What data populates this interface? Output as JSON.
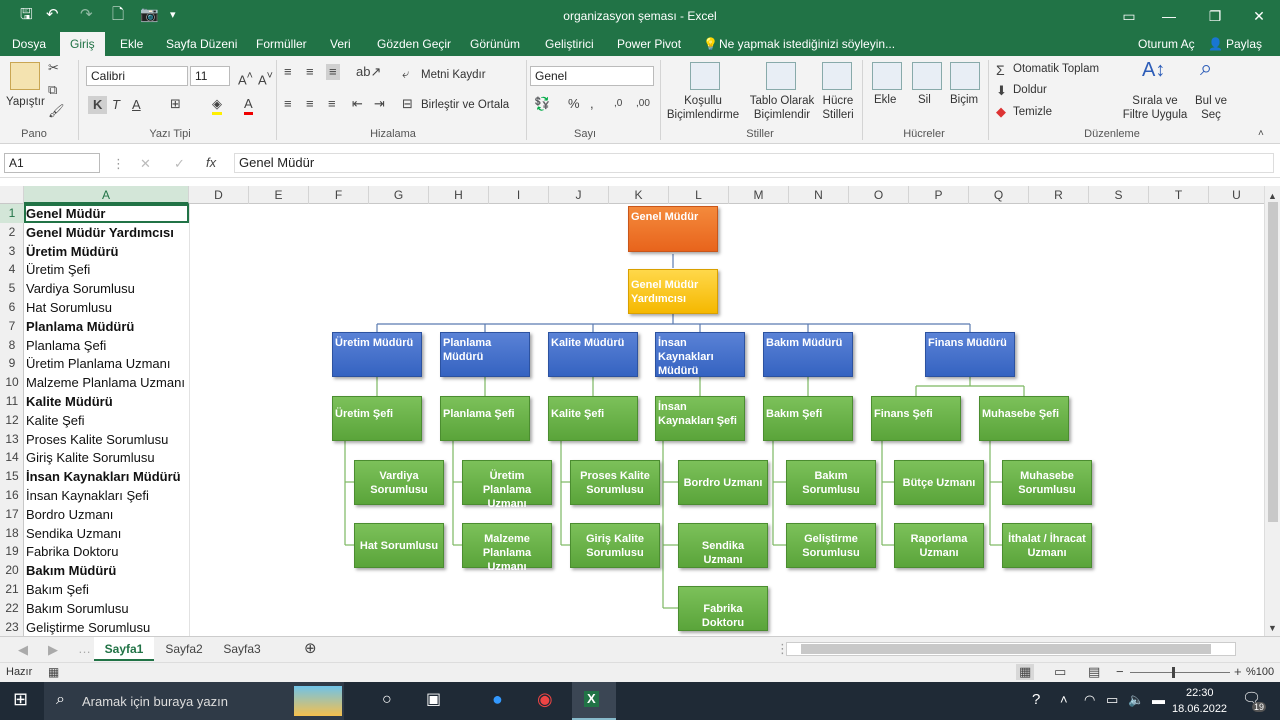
{
  "window": {
    "title": "organizasyon şeması - Excel"
  },
  "ribbon_tabs": [
    "Dosya",
    "Giriş",
    "Ekle",
    "Sayfa Düzeni",
    "Formüller",
    "Veri",
    "Gözden Geçir",
    "Görünüm",
    "Geliştirici",
    "Power Pivot"
  ],
  "tell_me": "Ne yapmak istediğinizi söyleyin...",
  "signin": "Oturum Aç",
  "share": "Paylaş",
  "ribbon": {
    "paste": "Yapıştır",
    "font_name": "Calibri",
    "font_size": "11",
    "wrap_text": "Metni Kaydır",
    "merge_center": "Birleştir ve Ortala",
    "number_format": "Genel",
    "conditional": "Koşullu Biçimlendirme",
    "table_format": "Tablo Olarak Biçimlendir",
    "cell_styles": "Hücre Stilleri",
    "insert": "Ekle",
    "delete": "Sil",
    "format": "Biçim",
    "autosum": "Otomatik Toplam",
    "fill": "Doldur",
    "clear": "Temizle",
    "sort_filter": "Sırala ve Filtre Uygula",
    "find_select": "Bul ve Seç",
    "groups": {
      "clipboard": "Pano",
      "font": "Yazı Tipi",
      "alignment": "Hizalama",
      "number": "Sayı",
      "styles": "Stiller",
      "cells": "Hücreler",
      "editing": "Düzenleme"
    }
  },
  "formula_bar": {
    "namebox": "A1",
    "content": "Genel Müdür"
  },
  "columns": [
    "A",
    "D",
    "E",
    "F",
    "G",
    "H",
    "I",
    "J",
    "K",
    "L",
    "M",
    "N",
    "O",
    "P",
    "Q",
    "R",
    "S",
    "T",
    "U"
  ],
  "rows": [
    {
      "n": "1",
      "text": "Genel Müdür",
      "bold": true
    },
    {
      "n": "2",
      "text": "Genel Müdür Yardımcısı",
      "bold": true
    },
    {
      "n": "3",
      "text": "Üretim Müdürü",
      "bold": true
    },
    {
      "n": "4",
      "text": "Üretim Şefi",
      "bold": false
    },
    {
      "n": "5",
      "text": "Vardiya Sorumlusu",
      "bold": false
    },
    {
      "n": "6",
      "text": "Hat Sorumlusu",
      "bold": false
    },
    {
      "n": "7",
      "text": "Planlama Müdürü",
      "bold": true
    },
    {
      "n": "8",
      "text": "Planlama Şefi",
      "bold": false
    },
    {
      "n": "9",
      "text": "Üretim Planlama Uzmanı",
      "bold": false
    },
    {
      "n": "10",
      "text": "Malzeme Planlama Uzmanı",
      "bold": false
    },
    {
      "n": "11",
      "text": "Kalite Müdürü",
      "bold": true
    },
    {
      "n": "12",
      "text": "Kalite Şefi",
      "bold": false
    },
    {
      "n": "13",
      "text": "Proses Kalite Sorumlusu",
      "bold": false
    },
    {
      "n": "14",
      "text": "Giriş Kalite Sorumlusu",
      "bold": false
    },
    {
      "n": "15",
      "text": "İnsan Kaynakları Müdürü",
      "bold": true
    },
    {
      "n": "16",
      "text": "İnsan Kaynakları Şefi",
      "bold": false
    },
    {
      "n": "17",
      "text": "Bordro Uzmanı",
      "bold": false
    },
    {
      "n": "18",
      "text": "Sendika Uzmanı",
      "bold": false
    },
    {
      "n": "19",
      "text": "Fabrika Doktoru",
      "bold": false
    },
    {
      "n": "20",
      "text": "Bakım Müdürü",
      "bold": true
    },
    {
      "n": "21",
      "text": "Bakım Şefi",
      "bold": false
    },
    {
      "n": "22",
      "text": "Bakım Sorumlusu",
      "bold": false
    },
    {
      "n": "23",
      "text": "Geliştirme Sorumlusu",
      "bold": false
    }
  ],
  "org": {
    "ceo": "Genel Müdür",
    "deputy": "Genel Müdür Yardımcısı",
    "managers": [
      "Üretim Müdürü",
      "Planlama Müdürü",
      "Kalite Müdürü",
      "İnsan Kaynakları Müdürü",
      "Bakım Müdürü",
      "Finans Müdürü"
    ],
    "chiefs": [
      "Üretim Şefi",
      "Planlama Şefi",
      "Kalite Şefi",
      "İnsan Kaynakları Şefi",
      "Bakım Şefi",
      "Finans Şefi",
      "Muhasebe Şefi"
    ],
    "staff": [
      [
        "Vardiya Sorumlusu",
        "Hat Sorumlusu"
      ],
      [
        "Üretim Planlama Uzmanı",
        "Malzeme Planlama Uzmanı"
      ],
      [
        "Proses Kalite Sorumlusu",
        "Giriş Kalite Sorumlusu"
      ],
      [
        "Bordro Uzmanı",
        "Sendika Uzmanı",
        "Fabrika Doktoru"
      ],
      [
        "Bakım Sorumlusu",
        "Geliştirme Sorumlusu"
      ],
      [
        "Bütçe Uzmanı",
        "Raporlama Uzmanı"
      ],
      [
        "Muhasebe Sorumlusu",
        "İthalat / İhracat Uzmanı"
      ]
    ]
  },
  "sheets": [
    "Sayfa1",
    "Sayfa2",
    "Sayfa3"
  ],
  "status": {
    "ready": "Hazır",
    "zoom": "%100"
  },
  "taskbar": {
    "search": "Aramak için buraya yazın",
    "time": "22:30",
    "date": "18.06.2022",
    "notif": "19"
  }
}
